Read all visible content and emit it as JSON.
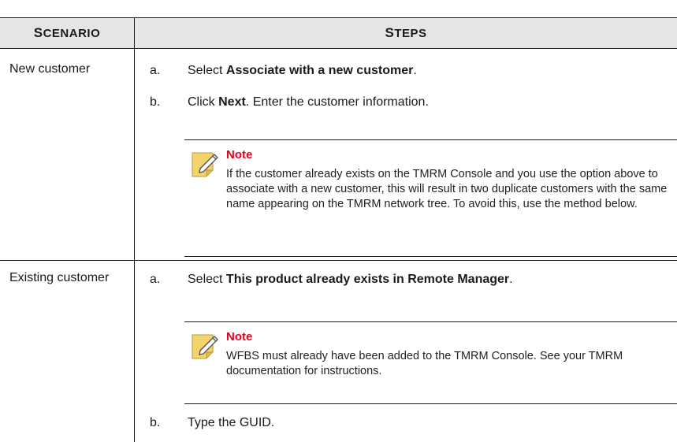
{
  "header": {
    "scenario_first": "S",
    "scenario_rest": "CENARIO",
    "steps_first": "S",
    "steps_rest": "TEPS"
  },
  "rows": [
    {
      "scenario": "New customer",
      "steps": [
        {
          "letter": "a.",
          "prefix": "Select ",
          "bold": "Associate with a new customer",
          "suffix": "."
        },
        {
          "letter": "b.",
          "prefix": "Click ",
          "bold": "Next",
          "suffix": ". Enter the customer information."
        }
      ],
      "note": {
        "icon": "note-pencil-icon",
        "title": "Note",
        "body": "If the customer already exists on the TMRM Console and you use the option above to associate with a new customer, this will result in two duplicate customers with the same name appearing on the TMRM network tree. To avoid this, use the method below."
      }
    },
    {
      "scenario": "Existing customer",
      "steps": [
        {
          "letter": "a.",
          "prefix": "Select ",
          "bold": "This product already exists in Remote Manager",
          "suffix": "."
        },
        {
          "letter": "b.",
          "prefix": "Type the GUID.",
          "bold": "",
          "suffix": ""
        }
      ],
      "note": {
        "icon": "note-pencil-icon",
        "title": "Note",
        "body": "WFBS must already have been added to the TMRM Console. See your TMRM documentation for instructions."
      }
    }
  ],
  "colors": {
    "note_title": "#e3001b",
    "header_bg": "#e5e5e5",
    "icon_fill": "#f3d36b"
  }
}
